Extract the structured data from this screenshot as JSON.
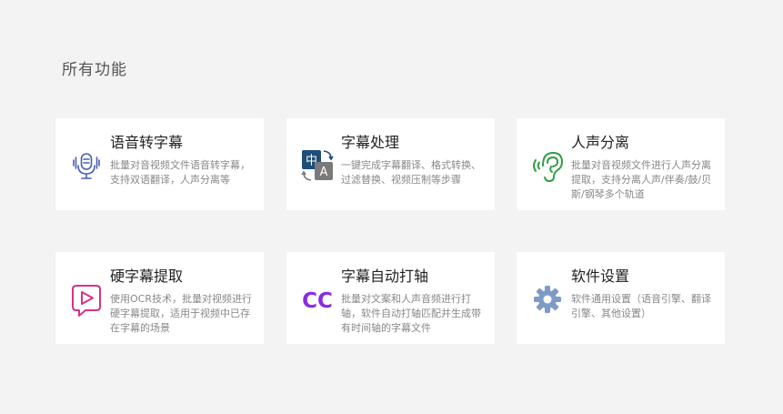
{
  "section": {
    "title": "所有功能"
  },
  "cards": [
    {
      "title": "语音转字幕",
      "desc": "批量对音视频文件语音转字幕，支持双语翻译，人声分离等",
      "icon": "microphone-icon"
    },
    {
      "title": "字幕处理",
      "desc": "一键完成字幕翻译、格式转换、过滤替换、视频压制等步骤",
      "icon": "translate-icon",
      "icon_glyphs": [
        "中",
        "A"
      ]
    },
    {
      "title": "人声分离",
      "desc": "批量对音视频文件进行人声分离提取，支持分离人声/伴奏/鼓/贝斯/钢琴多个轨道",
      "icon": "ear-sound-icon"
    },
    {
      "title": "硬字幕提取",
      "desc": "使用OCR技术，批量对视频进行硬字幕提取，适用于视频中已存在字幕的场景",
      "icon": "video-play-icon"
    },
    {
      "title": "字幕自动打轴",
      "desc": "批量对文案和人声音频进行打轴，软件自动打轴匹配并生成带有时间轴的字幕文件",
      "icon": "cc-icon",
      "icon_text": "CC"
    },
    {
      "title": "软件设置",
      "desc": "软件通用设置（语音引擎、翻译引擎、其他设置）",
      "icon": "gear-icon"
    }
  ],
  "colors": {
    "background": "#f3f3f3",
    "card": "#ffffff",
    "title": "#222222",
    "description": "#888888",
    "microphone": "#4a5fb0",
    "translate_dark": "#1f4e79",
    "translate_light": "#7a7a7a",
    "ear": "#2f9e44",
    "video_play": "#d63384",
    "cc": "#8a2be2",
    "gear": "#7f9ac7"
  }
}
